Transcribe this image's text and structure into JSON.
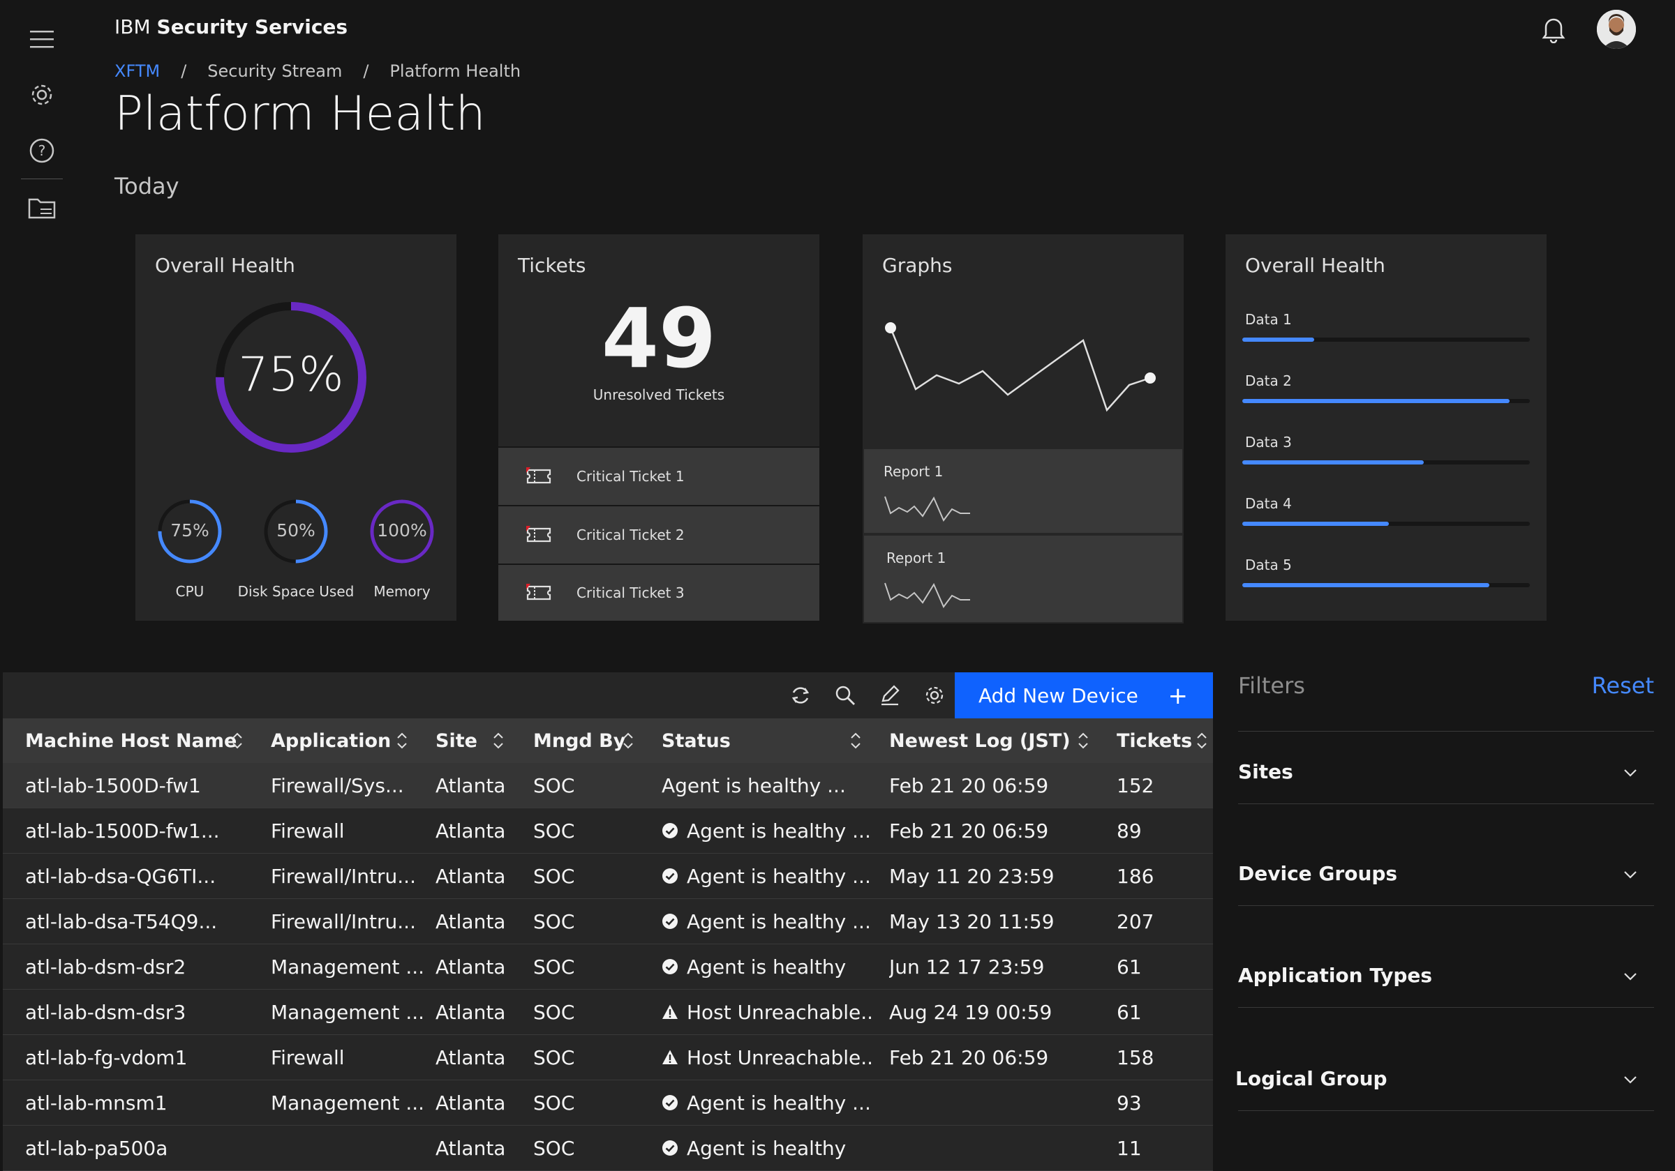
{
  "header": {
    "brand_prefix": "IBM",
    "brand_name": "Security Services"
  },
  "breadcrumb": {
    "items": [
      "XFTM",
      "Security Stream",
      "Platform Health"
    ],
    "separator": "/"
  },
  "page": {
    "title": "Platform Health",
    "period": "Today"
  },
  "colors": {
    "accent": "#0f62fe",
    "link": "#4589ff",
    "gauge_purple": "#6929c4",
    "gauge_blue": "#4589ff"
  },
  "cards": {
    "health": {
      "title": "Overall Health",
      "main_pct": "75%",
      "main_value": 0.75,
      "minis": [
        {
          "pct": "75%",
          "label": "CPU",
          "value": 0.75
        },
        {
          "pct": "50%",
          "label": "Disk Space Used",
          "value": 0.5
        },
        {
          "pct": "100%",
          "label": "Memory",
          "value": 1.0
        }
      ]
    },
    "tickets": {
      "title": "Tickets",
      "count": "49",
      "subtitle": "Unresolved Tickets",
      "items": [
        "Critical Ticket 1",
        "Critical Ticket 2",
        "Critical Ticket 3"
      ]
    },
    "graphs": {
      "title": "Graphs",
      "reports": [
        "Report 1",
        "Report 1"
      ]
    },
    "data_bars": {
      "title": "Overall Health",
      "bars": [
        {
          "label": "Data 1",
          "value": 0.25
        },
        {
          "label": "Data 2",
          "value": 0.93
        },
        {
          "label": "Data 3",
          "value": 0.63
        },
        {
          "label": "Data 4",
          "value": 0.51
        },
        {
          "label": "Data 5",
          "value": 0.86
        }
      ]
    }
  },
  "toolbar": {
    "refresh_icon": "refresh-icon",
    "search_icon": "search-icon",
    "edit_icon": "edit-icon",
    "settings_icon": "gear-icon",
    "add_label": "Add New Device",
    "add_plus": "+"
  },
  "table": {
    "columns": [
      "Machine Host Name",
      "Application",
      "Site",
      "Mngd By",
      "Status",
      "Newest Log (JST)",
      "Tickets"
    ],
    "rows": [
      {
        "host": "atl-lab-1500D-fw1",
        "app": "Firewall/Sys...",
        "site": "Atlanta",
        "mngd": "SOC",
        "status": "Agent is healthy ...",
        "icon": "none",
        "log": "Feb 21 20 06:59",
        "tickets": "152"
      },
      {
        "host": "atl-lab-1500D-fw1...",
        "app": "Firewall",
        "site": "Atlanta",
        "mngd": "SOC",
        "status": "Agent is healthy ...",
        "icon": "ok",
        "log": "Feb 21 20 06:59",
        "tickets": "89"
      },
      {
        "host": "atl-lab-dsa-QG6TI...",
        "app": "Firewall/Intru...",
        "site": "Atlanta",
        "mngd": "SOC",
        "status": "Agent is healthy ...",
        "icon": "ok",
        "log": "May 11 20 23:59",
        "tickets": "186"
      },
      {
        "host": "atl-lab-dsa-T54Q9...",
        "app": "Firewall/Intru...",
        "site": "Atlanta",
        "mngd": "SOC",
        "status": "Agent is healthy ...",
        "icon": "ok",
        "log": "May 13 20 11:59",
        "tickets": "207"
      },
      {
        "host": "atl-lab-dsm-dsr2",
        "app": "Management ...",
        "site": "Atlanta",
        "mngd": "SOC",
        "status": "Agent is healthy",
        "icon": "ok",
        "log": "Jun 12 17 23:59",
        "tickets": "61"
      },
      {
        "host": "atl-lab-dsm-dsr3",
        "app": "Management ...",
        "site": "Atlanta",
        "mngd": "SOC",
        "status": "Host Unreachable...",
        "icon": "warn",
        "log": "Aug 24 19 00:59",
        "tickets": "61"
      },
      {
        "host": "atl-lab-fg-vdom1",
        "app": "Firewall",
        "site": "Atlanta",
        "mngd": "SOC",
        "status": "Host Unreachable...",
        "icon": "warn",
        "log": "Feb 21 20 06:59",
        "tickets": "158"
      },
      {
        "host": "atl-lab-mnsm1",
        "app": "Management ...",
        "site": "Atlanta",
        "mngd": "SOC",
        "status": "Agent is healthy ...",
        "icon": "ok",
        "log": "",
        "tickets": "93"
      },
      {
        "host": "atl-lab-pa500a",
        "app": "",
        "site": "Atlanta",
        "mngd": "SOC",
        "status": "Agent is healthy",
        "icon": "ok",
        "log": "",
        "tickets": "11"
      }
    ]
  },
  "filters": {
    "title": "Filters",
    "reset": "Reset",
    "groups": [
      "Sites",
      "Device Groups",
      "Application Types",
      "Logical Group"
    ]
  }
}
